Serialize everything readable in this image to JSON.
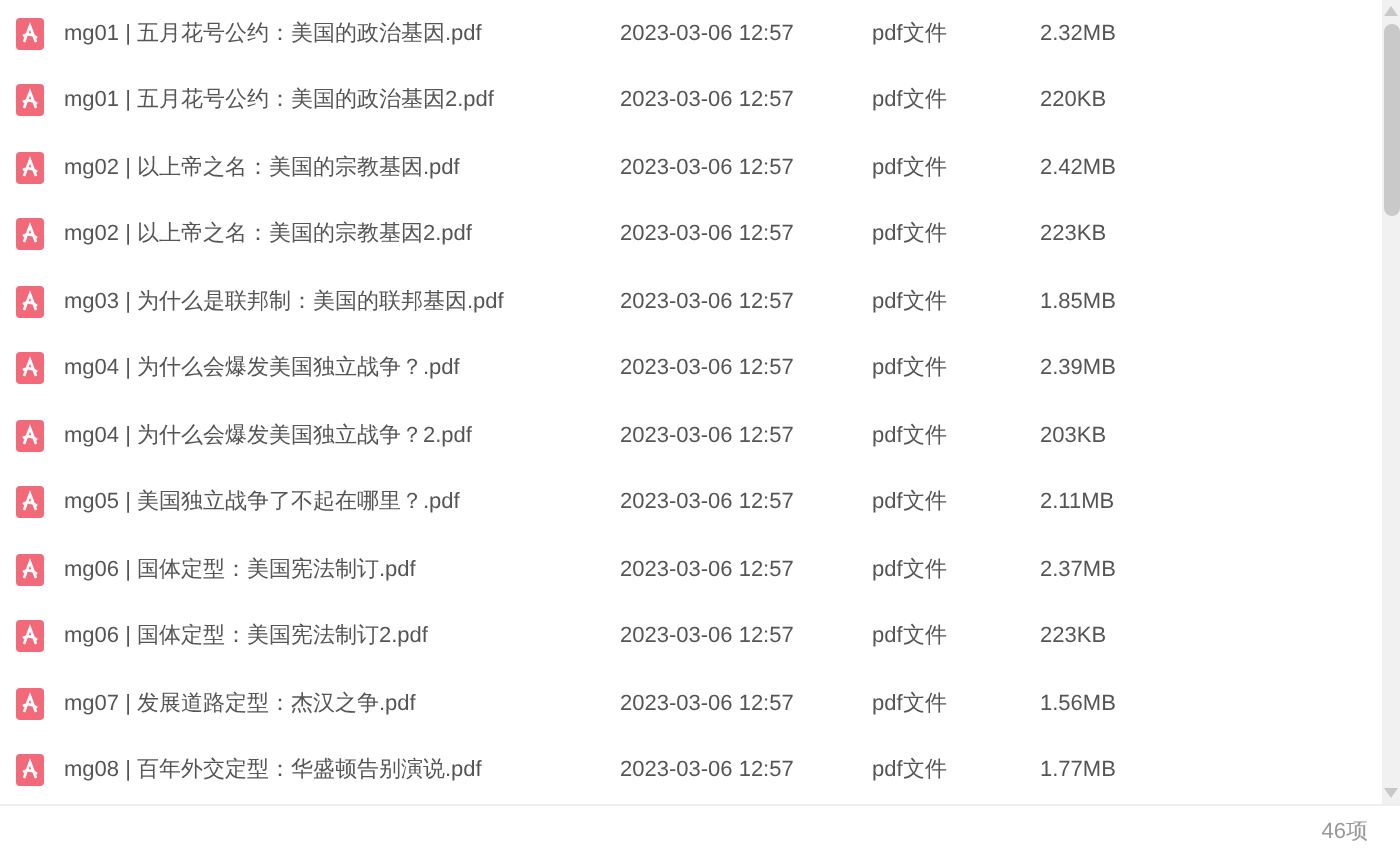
{
  "files": [
    {
      "name": "mg01 | 五月花号公约：美国的政治基因.pdf",
      "date": "2023-03-06 12:57",
      "type": "pdf文件",
      "size": "2.32MB"
    },
    {
      "name": "mg01 | 五月花号公约：美国的政治基因2.pdf",
      "date": "2023-03-06 12:57",
      "type": "pdf文件",
      "size": "220KB"
    },
    {
      "name": "mg02 | 以上帝之名：美国的宗教基因.pdf",
      "date": "2023-03-06 12:57",
      "type": "pdf文件",
      "size": "2.42MB"
    },
    {
      "name": "mg02 | 以上帝之名：美国的宗教基因2.pdf",
      "date": "2023-03-06 12:57",
      "type": "pdf文件",
      "size": "223KB"
    },
    {
      "name": "mg03 | 为什么是联邦制：美国的联邦基因.pdf",
      "date": "2023-03-06 12:57",
      "type": "pdf文件",
      "size": "1.85MB"
    },
    {
      "name": "mg04 | 为什么会爆发美国独立战争？.pdf",
      "date": "2023-03-06 12:57",
      "type": "pdf文件",
      "size": "2.39MB"
    },
    {
      "name": "mg04 | 为什么会爆发美国独立战争？2.pdf",
      "date": "2023-03-06 12:57",
      "type": "pdf文件",
      "size": "203KB"
    },
    {
      "name": "mg05 | 美国独立战争了不起在哪里？.pdf",
      "date": "2023-03-06 12:57",
      "type": "pdf文件",
      "size": "2.11MB"
    },
    {
      "name": "mg06 | 国体定型：美国宪法制订.pdf",
      "date": "2023-03-06 12:57",
      "type": "pdf文件",
      "size": "2.37MB"
    },
    {
      "name": "mg06 | 国体定型：美国宪法制订2.pdf",
      "date": "2023-03-06 12:57",
      "type": "pdf文件",
      "size": "223KB"
    },
    {
      "name": "mg07 | 发展道路定型：杰汉之争.pdf",
      "date": "2023-03-06 12:57",
      "type": "pdf文件",
      "size": "1.56MB"
    },
    {
      "name": "mg08 | 百年外交定型：华盛顿告别演说.pdf",
      "date": "2023-03-06 12:57",
      "type": "pdf文件",
      "size": "1.77MB"
    }
  ],
  "status_bar": {
    "count": "46项"
  }
}
